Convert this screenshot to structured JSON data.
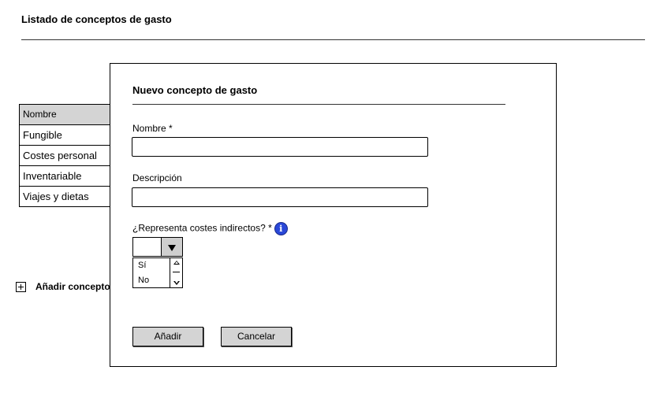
{
  "page": {
    "title": "Listado de conceptos de gasto"
  },
  "table": {
    "header": "Nombre",
    "rows": [
      "Fungible",
      "Costes personal",
      "Inventariable",
      "Viajes y dietas"
    ]
  },
  "add_link": {
    "label": "Añadir concepto",
    "icon": "plus-square-icon"
  },
  "modal": {
    "title": "Nuevo concepto de gasto",
    "name_label": "Nombre *",
    "name_value": "",
    "description_label": "Descripción",
    "description_value": "",
    "indirect_label": "¿Representa costes indirectos? *",
    "info_icon": "i",
    "select_value": "",
    "options": [
      "Sí",
      "No"
    ],
    "add_button": "Añadir",
    "cancel_button": "Cancelar"
  },
  "colors": {
    "header_bg": "#d4d4d4",
    "info_icon": "#2a48d8",
    "button_bg": "#d4d4d4"
  }
}
